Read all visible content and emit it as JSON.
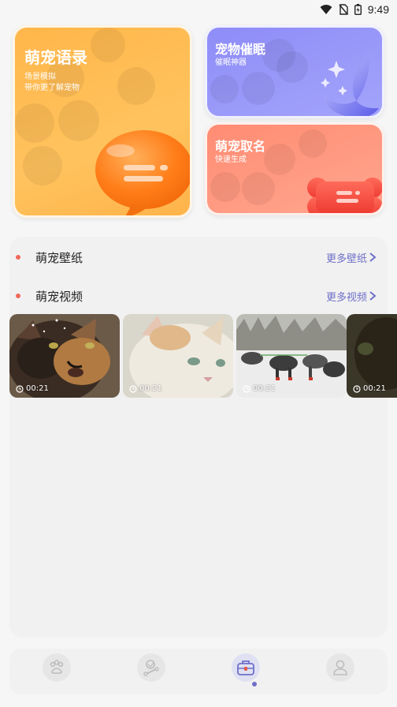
{
  "status": {
    "time": "9:49"
  },
  "cards": {
    "left": {
      "title": "萌宠语录",
      "sub1": "场景模拟",
      "sub2": "带你更了解宠物"
    },
    "right_top": {
      "title": "宠物催眠",
      "sub": "催眠神器"
    },
    "right_bottom": {
      "title": "萌宠取名",
      "sub": "快速生成"
    }
  },
  "sections": {
    "wallpaper": {
      "title": "萌宠壁纸",
      "more": "更多壁纸"
    },
    "video": {
      "title": "萌宠视频",
      "more": "更多视频"
    }
  },
  "videos": [
    {
      "duration": "00:21",
      "subject": "tortoiseshell cat"
    },
    {
      "duration": "00:21",
      "subject": "white cat"
    },
    {
      "duration": "00:21",
      "subject": "sled dogs"
    },
    {
      "duration": "00:21",
      "subject": "dark animal"
    }
  ],
  "nav": {
    "items": [
      "paw-icon",
      "pet-bowl-icon",
      "toolbox-icon",
      "profile-icon"
    ],
    "active_index": 2
  },
  "colors": {
    "orange": "#ffb64a",
    "purple": "#8e8cf7",
    "coral": "#ff8c73",
    "accent": "#6f70c8",
    "bullet": "#f0685a"
  }
}
